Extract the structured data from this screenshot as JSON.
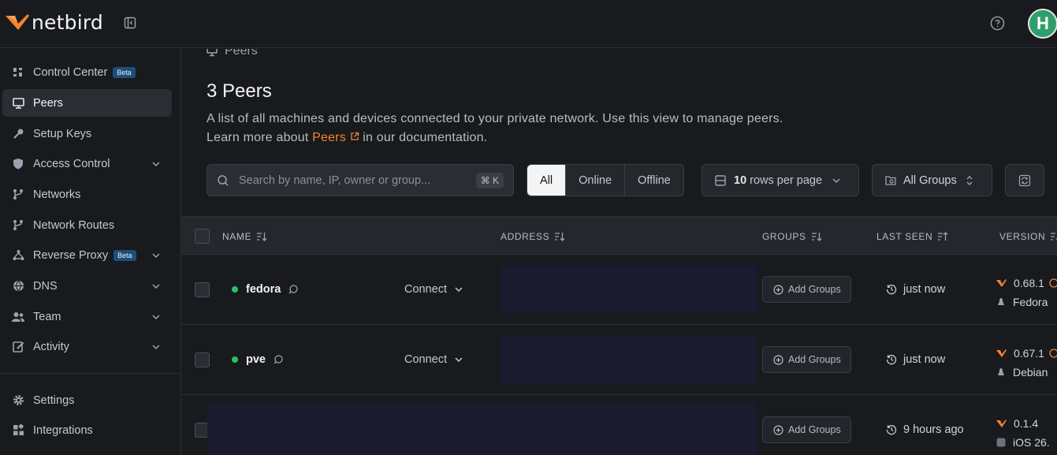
{
  "header": {
    "logo_text": "netbird",
    "avatar_initial": "H"
  },
  "sidebar": {
    "items": [
      {
        "label": "Control Center",
        "badge": "Beta"
      },
      {
        "label": "Peers"
      },
      {
        "label": "Setup Keys"
      },
      {
        "label": "Access Control"
      },
      {
        "label": "Networks"
      },
      {
        "label": "Network Routes"
      },
      {
        "label": "Reverse Proxy",
        "badge": "Beta"
      },
      {
        "label": "DNS"
      },
      {
        "label": "Team"
      },
      {
        "label": "Activity"
      },
      {
        "label": "Settings"
      },
      {
        "label": "Integrations"
      }
    ]
  },
  "main": {
    "breadcrumb": "Peers",
    "title": "3 Peers",
    "desc_line1": "A list of all machines and devices connected to your private network. Use this view to manage peers.",
    "desc_pre": "Learn more about ",
    "desc_link": "Peers",
    "desc_post": " in our documentation.",
    "search_placeholder": "Search by name, IP, owner or group...",
    "search_shortcut": "⌘ K",
    "filters": [
      "All",
      "Online",
      "Offline"
    ],
    "rows_per_page_value": "10",
    "rows_per_page_suffix": "rows per page",
    "groups_filter": "All Groups"
  },
  "table": {
    "columns": [
      "NAME",
      "ADDRESS",
      "GROUPS",
      "LAST SEEN",
      "VERSION"
    ],
    "rows": [
      {
        "name": "fedora",
        "connect": "Connect",
        "groups": "Add Groups",
        "last_seen": "just now",
        "version": "0.68.1",
        "os": "Fedora"
      },
      {
        "name": "pve",
        "connect": "Connect",
        "groups": "Add Groups",
        "last_seen": "just now",
        "version": "0.67.1",
        "os": "Debian"
      },
      {
        "name": "",
        "connect": "",
        "groups": "Add Groups",
        "last_seen": "9 hours ago",
        "version": "0.1.4",
        "os": "iOS 26."
      }
    ]
  },
  "colors": {
    "accent": "#f68330",
    "online": "#22c55e",
    "active_bg": "#2a2d33"
  }
}
